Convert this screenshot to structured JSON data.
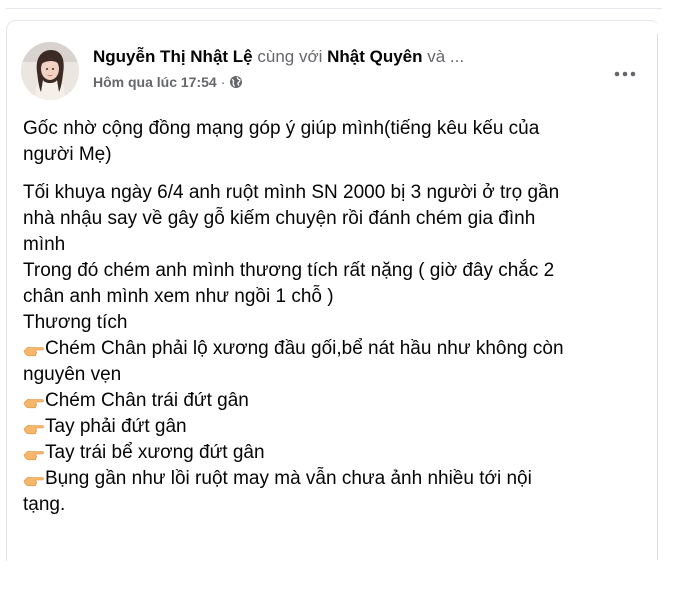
{
  "post": {
    "author": "Nguyễn Thị Nhật Lệ",
    "with_text": "cùng với",
    "tagged": "Nhật Quyên",
    "and_more": "và ...",
    "time": "Hôm qua lúc 17:54",
    "separator": "·",
    "privacy_icon": "globe-icon",
    "more_icon": "more-options-icon",
    "intro_lines": [
      "Gốc nhờ cộng đồng mạng góp ý giúp mình(tiếng kêu kếu của",
      "người Mẹ)"
    ],
    "story_lines": [
      "Tối khuya ngày 6/4 anh ruột mình SN 2000 bị 3 người ở trọ gần",
      "nhà nhậu say về gây gỗ kiếm chuyện rồi đánh chém gia đình",
      "mình",
      "Trong đó chém anh mình thương tích rất nặng ( giờ đây chắc 2",
      "chân anh mình xem như ngồi 1 chỗ )",
      "Thương tích"
    ],
    "injuries": [
      {
        "icon": "pointing-hand-icon",
        "text": "Chém Chân phải lộ xương đầu gối,bể nát hầu như không còn",
        "cont": "nguyên vẹn"
      },
      {
        "icon": "pointing-hand-icon",
        "text": "Chém Chân trái đứt gân"
      },
      {
        "icon": "pointing-hand-icon",
        "text": "Tay phải đứt gân"
      },
      {
        "icon": "pointing-hand-icon",
        "text": "Tay trái bể xương đứt gân"
      },
      {
        "icon": "pointing-hand-icon",
        "text": "Bụng gần như lồi ruột may mà vẫn chưa ảnh nhiều tới nội",
        "cont": "tạng."
      }
    ]
  },
  "colors": {
    "text_primary": "#050505",
    "text_secondary": "#65676b",
    "divider": "#e4e6eb",
    "hand_icon": "#f5b86a"
  }
}
